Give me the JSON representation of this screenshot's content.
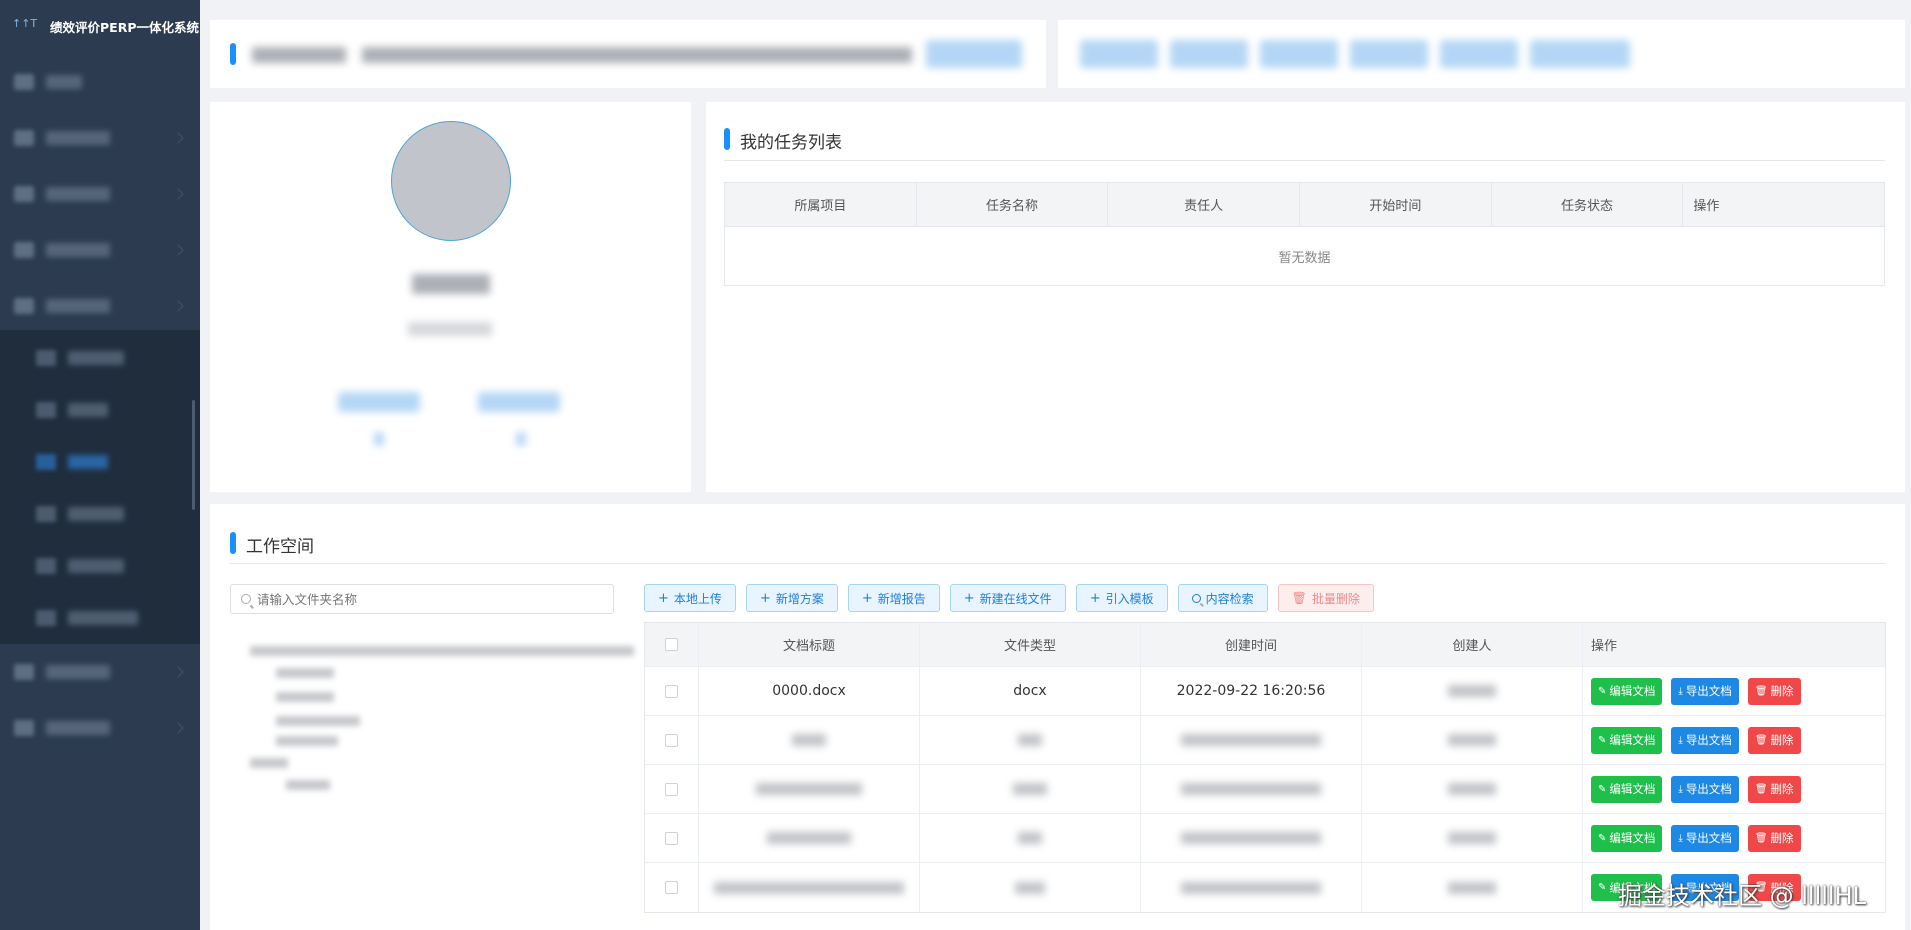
{
  "app": {
    "title": "绩效评价PERP一体化系统",
    "logo_glyphs": "↑↑T"
  },
  "tasks": {
    "title": "我的任务列表",
    "columns": [
      "所属项目",
      "任务名称",
      "责任人",
      "开始时间",
      "任务状态",
      "操作"
    ],
    "empty_text": "暂无数据"
  },
  "workspace": {
    "title": "工作空间",
    "search_placeholder": "请输入文件夹名称",
    "toolbar": {
      "upload": "本地上传",
      "new_plan": "新增方案",
      "new_report": "新增报告",
      "new_online": "新建在线文件",
      "import_template": "引入模板",
      "content_search": "内容检索",
      "batch_delete": "批量删除"
    },
    "columns": [
      "文档标题",
      "文件类型",
      "创建时间",
      "创建人",
      "操作"
    ],
    "rows": [
      {
        "title": "0000.docx",
        "type": "docx",
        "created": "2022-09-22 16:20:56"
      }
    ],
    "row_actions": {
      "edit": "编辑文档",
      "export": "导出文档",
      "delete": "删除"
    }
  },
  "watermark": "掘金技术社区 @ lllllHL",
  "colors": {
    "sidebar": "#2c3b4f",
    "accent": "#1890ff",
    "green": "#1fbf4c",
    "blue": "#1e88e5",
    "red": "#f04848"
  }
}
